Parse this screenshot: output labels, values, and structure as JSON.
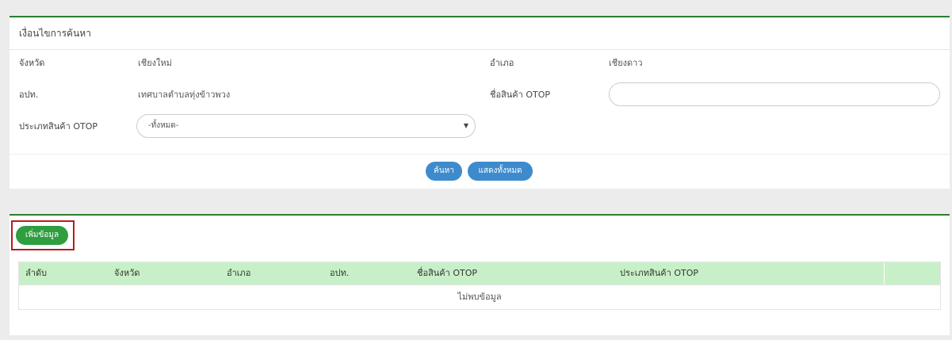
{
  "search": {
    "title": "เงื่อนไขการค้นหา",
    "province_label": "จังหวัด",
    "province_value": "เชียงใหม่",
    "district_label": "อำเภอ",
    "district_value": "เชียงดาว",
    "lao_label": "อปท.",
    "lao_value": "เทศบาลตำบลทุ่งข้าวพวง",
    "product_name_label": "ชื่อสินค้า OTOP",
    "product_name_value": "",
    "product_type_label": "ประเภทสินค้า OTOP",
    "product_type_selected": "-ทั้งหมด-",
    "search_button": "ค้นหา",
    "show_all_button": "แสดงทั้งหมด"
  },
  "results": {
    "add_button": "เพิ่มข้อมูล",
    "columns": [
      "ลำดับ",
      "จังหวัด",
      "อำเภอ",
      "อปท.",
      "ชื่อสินค้า OTOP",
      "ประเภทสินค้า OTOP"
    ],
    "empty_message": "ไม่พบข้อมูล"
  },
  "colors": {
    "panel_border": "#2e7d32",
    "primary_button": "#3d8bcd",
    "add_button": "#2e9e3f",
    "table_header_bg": "#c8f0c8",
    "highlight_box": "#b71c1c"
  }
}
